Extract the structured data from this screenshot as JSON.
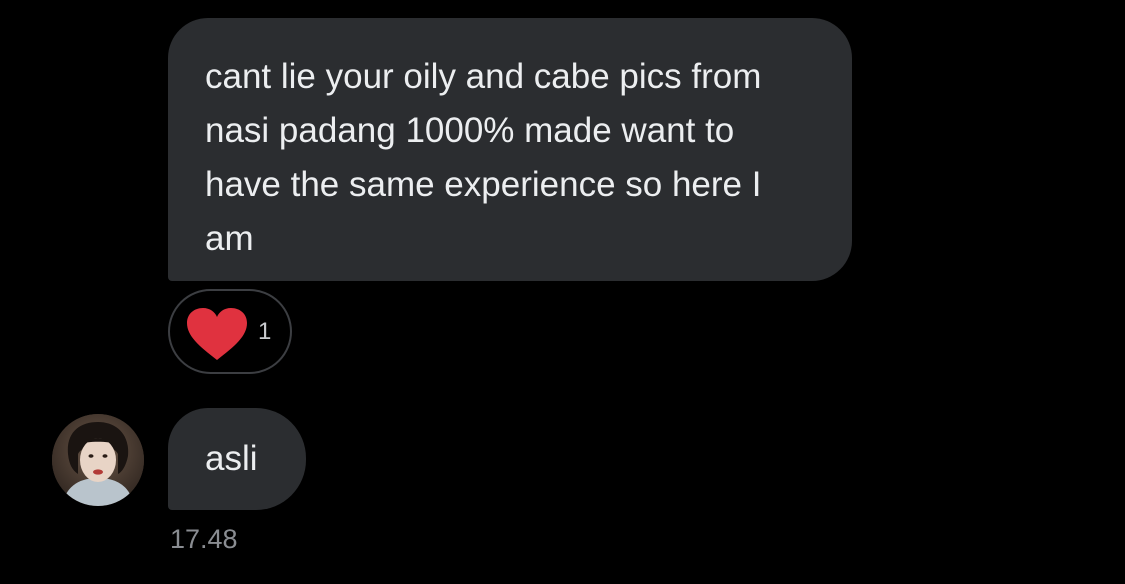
{
  "conversation": {
    "messages": [
      {
        "text": "cant lie your oily and cabe pics from nasi padang 1000% made want to have the same experience so here I am",
        "reaction": {
          "icon": "heart-icon",
          "color": "#e0323f",
          "count": "1"
        }
      },
      {
        "text": "asli",
        "avatar": "profile-avatar",
        "timestamp": "17.48"
      }
    ]
  },
  "colors": {
    "background": "#000000",
    "bubble": "#2b2d30",
    "heart": "#e0323f",
    "timestamp": "#8a8d92"
  }
}
